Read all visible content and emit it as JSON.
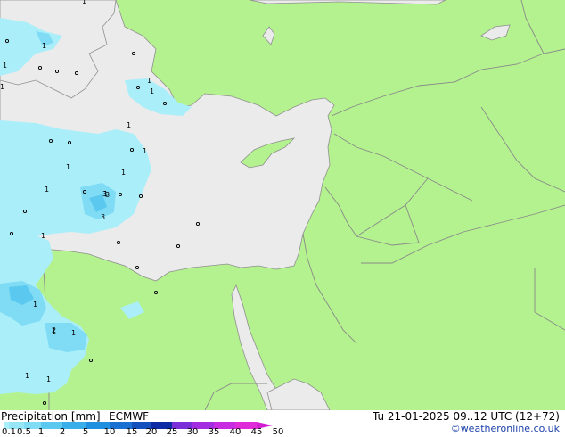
{
  "map": {
    "colors": {
      "land": "#b3f28e",
      "sea": "#ebebeb",
      "borders": "#8a8a8a",
      "coast": "#909090",
      "precip_light": "#aaeefa",
      "precip_mid": "#7fdcf4",
      "precip_heavy": "#5ac8ef"
    },
    "precip_labels": [
      "1",
      "1",
      "1",
      "1",
      "1",
      "1",
      "1",
      "1",
      "1",
      "1",
      "1",
      "1",
      "1",
      "1",
      "1",
      "1",
      "2",
      "3",
      "3",
      "1",
      "1",
      "3"
    ]
  },
  "footer": {
    "title": "Precipitation [mm]",
    "model": "ECMWF",
    "valid_time": "Tu 21-01-2025 09..12 UTC (12+72)",
    "credit": "©weatheronline.co.uk"
  },
  "legend": {
    "ticks": [
      "0.1",
      "0.5",
      "1",
      "2",
      "5",
      "10",
      "15",
      "20",
      "25",
      "30",
      "35",
      "40",
      "45",
      "50"
    ],
    "colors": [
      "#aaeefa",
      "#96e6f7",
      "#7fdcf4",
      "#5ac8ef",
      "#3aaee8",
      "#1f8fe0",
      "#1a6fd2",
      "#1450bd",
      "#0c2aa3",
      "#7a2fd8",
      "#a32de0",
      "#c82be2",
      "#e02bd8",
      "#d31fd3"
    ]
  }
}
